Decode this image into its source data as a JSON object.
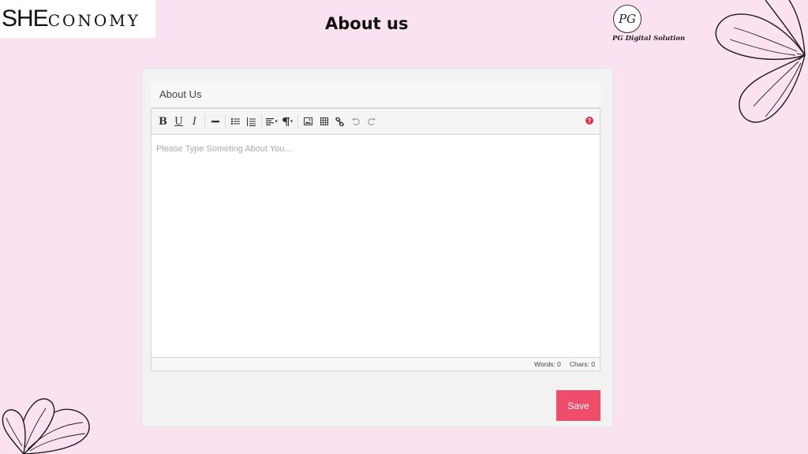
{
  "brand": {
    "she": "SHE",
    "rest": "CONOMY"
  },
  "slide": {
    "title": "About us"
  },
  "pg_logo": {
    "monogram": "PG",
    "caption": "PG Digital Solution"
  },
  "panel": {
    "title": "About Us"
  },
  "editor": {
    "placeholder": "Please Type Someting About You...",
    "toolbar": {
      "bold": "B",
      "underline": "U",
      "italic": "I",
      "help": "?"
    },
    "footer": {
      "words": "Words: 0",
      "chars": "Chars: 0"
    }
  },
  "actions": {
    "save_label": "Save"
  },
  "colors": {
    "background": "#fbe2f1",
    "save": "#ef4d6c",
    "help": "#d9304a"
  }
}
